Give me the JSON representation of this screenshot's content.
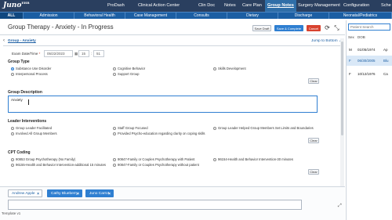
{
  "app": {
    "logo": "Juno",
    "logo_sup": "EHR"
  },
  "topnav": {
    "items": [
      "ProDash",
      "Clinical Action Center",
      "Clin Doc",
      "Notes",
      "Care Plan",
      "Group Notes",
      "Surgery Management",
      "Configuration",
      "Sche"
    ],
    "active": "Group Notes"
  },
  "subnav": {
    "items": [
      "ALL",
      "Admission",
      "Behavioral Health",
      "Case Management",
      "Consults",
      "Dietary",
      "Discharge",
      "Neonatal/Pediatrics"
    ],
    "active": "ALL"
  },
  "header": {
    "title": "Group Therapy - Anxiety - In Progress",
    "save_draft": "Save Draft",
    "save_complete": "Save & Complete",
    "cancel": "Cancel"
  },
  "sidebar": {
    "search_placeholder": "Patient Search",
    "col_sex": "Sex",
    "col_dob": "DOB",
    "rows": [
      {
        "sex": "M",
        "dob": "01/05/1974",
        "extra": "Ap",
        "highlight": false
      },
      {
        "sex": "F",
        "dob": "06/30/2005",
        "extra": "Blu",
        "highlight": true
      },
      {
        "sex": "F",
        "dob": "10/12/1976",
        "extra": "Ca",
        "highlight": false
      }
    ]
  },
  "form": {
    "tab": "Group - Anxiety",
    "jump": "Jump to Bottom",
    "exam_label": "Exam Date/Time",
    "exam_date": "05/22/2023",
    "exam_hour": "15",
    "exam_min": "51",
    "group_type": {
      "title": "Group Type",
      "options": [
        "Substance Use Disorder",
        "Cognitive Behavior",
        "Skills Development",
        "Interpersonal Process",
        "Support Group"
      ],
      "clear": "Clear"
    },
    "group_description": {
      "title": "Group Description",
      "value": "Anxiety"
    },
    "leader_interventions": {
      "title": "Leader Interventions",
      "options": [
        "Group Leader Facilitated",
        "Staff Group Focused",
        "Group Leader Helped Group Members Set Limits and Boundaries",
        "Involved All Group Members",
        "Provided Psycho-education regarding clarity on coping skills"
      ],
      "clear": "Clear"
    },
    "cpt_coding": {
      "title": "CPT Coding",
      "options": [
        "90853 Group Psychotherapy (No Family)",
        "90847-Family or Couples Psychotherapy with Patient",
        "96154-Health and Behavior Intervention-30 minutes",
        "96155-Health and Behavior Intervention-additional 15 minutes",
        "90847-Family or Couples Psychotherapy without patient"
      ],
      "clear": "Clear"
    }
  },
  "patient_tabs": [
    {
      "name": "Andrew Apple",
      "active": false
    },
    {
      "name": "Cathy Blueberry",
      "active": true
    },
    {
      "name": "Juno Carrot",
      "active": true
    }
  ],
  "footer": {
    "label": "Template v1"
  }
}
